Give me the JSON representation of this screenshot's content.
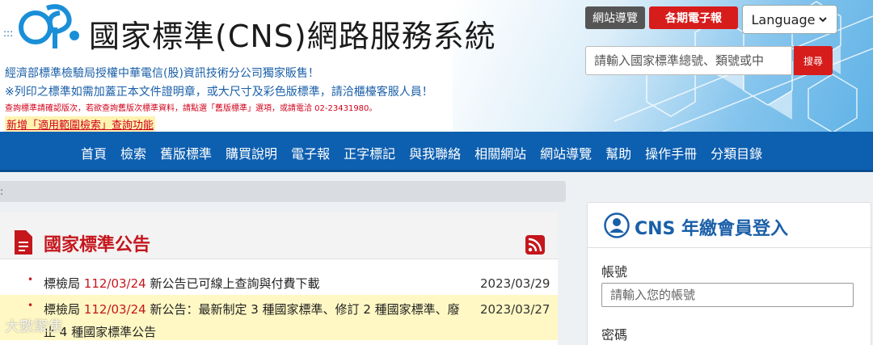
{
  "header": {
    "site_title": "國家標準(CNS)網路服務系統",
    "notices": [
      "經濟部標準檢驗局授權中華電信(股)資訊技術分公司獨家販售！",
      "※列印之標準如需加蓋正本文件證明章，或大尺寸及彩色版標準，請洽櫃檯客服人員！",
      "查詢標準請確認版次，若欲查詢舊版次標準資料，請點選「舊版標準」選項，或請電洽 02-23431980。",
      "新增「適用範圍檢索」查詢功能"
    ],
    "sitemap_label": "網站導覽",
    "epaper_label": "各期電子報",
    "language_label": "Language",
    "search_placeholder": "請輸入國家標準總號、類號或中",
    "search_button": "搜尋",
    "colors": {
      "brand_blue": "#0d5fb0",
      "accent_red": "#d71c1c"
    }
  },
  "nav": {
    "items": [
      "首頁",
      "檢索",
      "舊版標準",
      "購買說明",
      "電子報",
      "正字標記",
      "與我聯絡",
      "相關網站",
      "網站導覽",
      "幫助",
      "操作手冊",
      "分類目錄"
    ]
  },
  "announcements": {
    "title": "國家標準公告",
    "items": [
      {
        "prefix": "標檢局 ",
        "date_ref": "112/03/24",
        "text": " 新公告已可線上查詢與付費下載",
        "date": "2023/03/29"
      },
      {
        "prefix": "標檢局 ",
        "date_ref": "112/03/24",
        "text": " 新公告：最新制定 3 種國家標準、修訂 2 種國家標準、廢止 4 種國家標準公告",
        "date": "2023/03/27"
      }
    ]
  },
  "login": {
    "title": "CNS 年繳會員登入",
    "account_label": "帳號",
    "account_placeholder": "請輸入您的帳號",
    "password_label": "密碼"
  },
  "watermark": "大數聚焦"
}
